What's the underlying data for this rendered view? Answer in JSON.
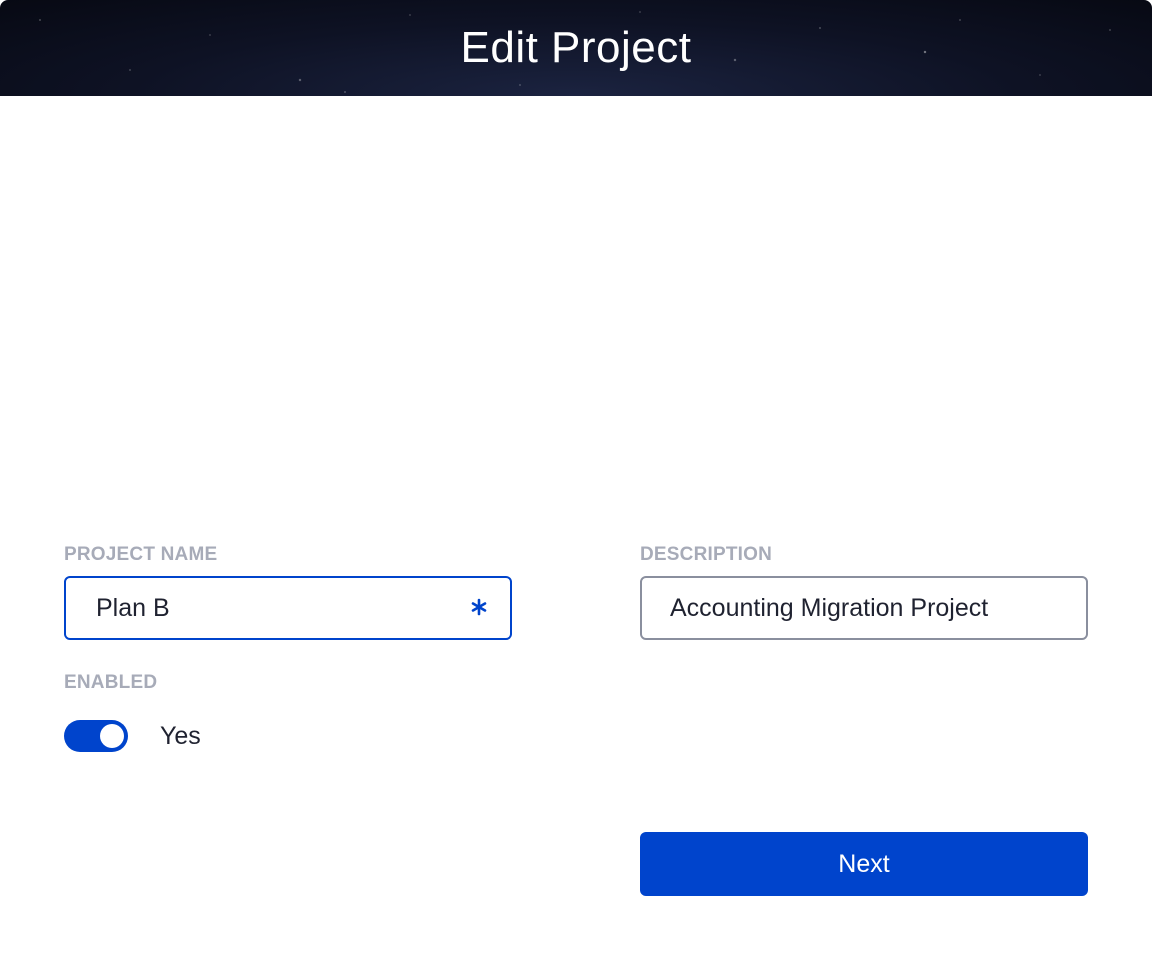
{
  "header": {
    "title": "Edit Project"
  },
  "form": {
    "project_name": {
      "label": "PROJECT NAME",
      "value": "Plan B",
      "required_icon": "asterisk-icon"
    },
    "description": {
      "label": "DESCRIPTION",
      "value": "Accounting Migration Project"
    },
    "enabled": {
      "label": "ENABLED",
      "state": true,
      "state_text": "Yes"
    }
  },
  "actions": {
    "next_label": "Next"
  },
  "colors": {
    "accent": "#0044cc",
    "label_gray": "#a7abb8",
    "text": "#1f2230",
    "input_border": "#8a8f9e",
    "header_bg": "#0e1224"
  }
}
